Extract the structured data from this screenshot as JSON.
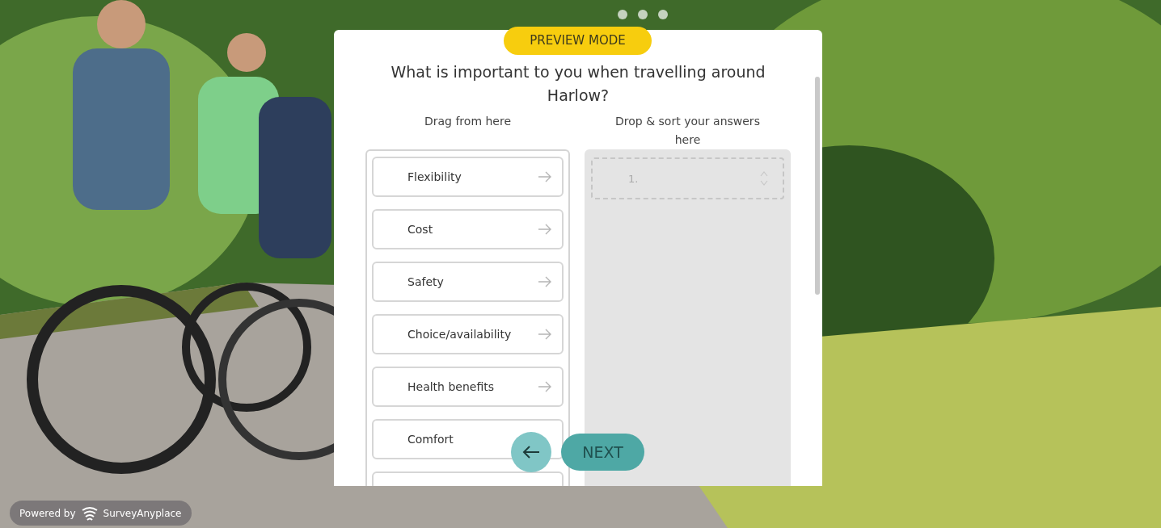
{
  "preview_badge": "PREVIEW MODE",
  "question": "What is important to you when travelling around Harlow?",
  "source": {
    "heading": "Drag from here",
    "items": [
      {
        "label": "Flexibility"
      },
      {
        "label": "Cost"
      },
      {
        "label": "Safety"
      },
      {
        "label": "Choice/availability"
      },
      {
        "label": "Health benefits"
      },
      {
        "label": "Comfort"
      }
    ]
  },
  "target": {
    "heading": "Drop & sort your answers here",
    "slots": [
      "1."
    ]
  },
  "buttons": {
    "next": "NEXT"
  },
  "branding": {
    "prefix": "Powered by",
    "name": "SurveyAnyplace"
  }
}
